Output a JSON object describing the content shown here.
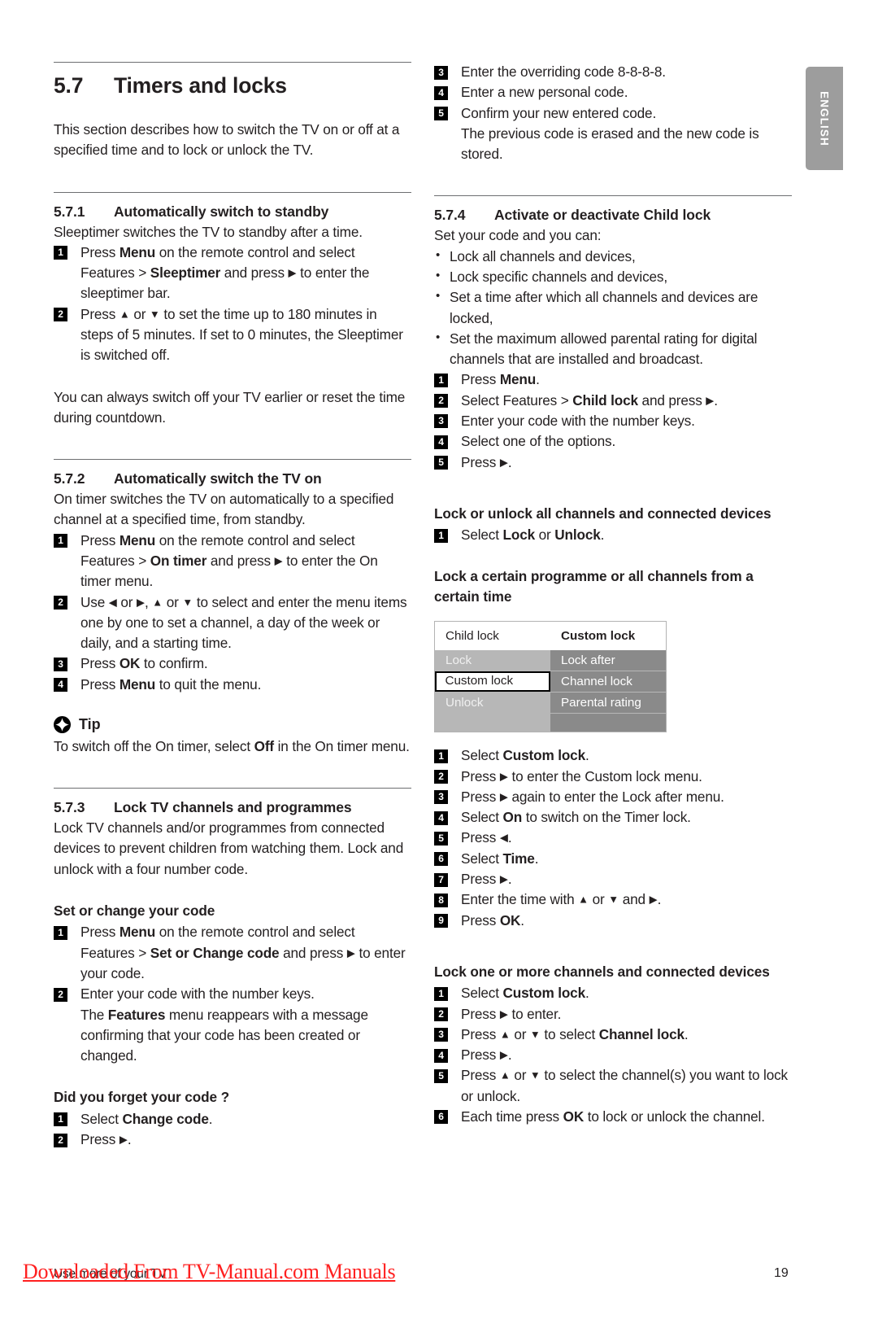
{
  "page": {
    "language_tab": "ENGLISH",
    "page_number": "19",
    "footer_text": "Use more of your TV",
    "watermark": "Downloaded From TV-Manual.com Manuals"
  },
  "left_column": {
    "section": {
      "number": "5.7",
      "title": "Timers and locks",
      "intro": "This section describes how to switch the TV on or off at a specified time and to lock or unlock the TV."
    },
    "sub_571": {
      "number": "5.7.1",
      "title": "Automatically switch to standby",
      "intro": "Sleeptimer switches the TV to standby after a time.",
      "steps": [
        {
          "n": "1",
          "html": "Press <b>Menu</b> on the remote control and select Features &gt; <b>Sleeptimer</b> and press <span class=\"arrow\">▶</span> to enter the sleeptimer bar."
        },
        {
          "n": "2",
          "html": "Press <span class=\"arrow\">▲</span> or <span class=\"arrow\">▼</span> to set the time up to 180 minutes in steps of 5 minutes. If set to 0 minutes, the Sleeptimer is switched off."
        }
      ],
      "note": "You can always switch off your TV earlier or reset the time during countdown."
    },
    "sub_572": {
      "number": "5.7.2",
      "title": "Automatically switch the TV on",
      "intro": "On timer switches the TV on automatically to a specified channel at a specified time, from standby.",
      "steps": [
        {
          "n": "1",
          "html": "Press <b>Menu</b> on the remote control and select Features &gt; <b>On timer</b> and press <span class=\"arrow\">▶</span> to enter the On timer menu."
        },
        {
          "n": "2",
          "html": "Use <span class=\"arrow\">◀</span> or <span class=\"arrow\">▶</span>, <span class=\"arrow\">▲</span> or <span class=\"arrow\">▼</span> to select and enter the menu items one by one to set a channel, a day of the week or daily, and a starting time."
        },
        {
          "n": "3",
          "html": "Press <b>OK</b> to confirm."
        },
        {
          "n": "4",
          "html": "Press <b>Menu</b> to quit the menu."
        }
      ],
      "tip_label": "Tip",
      "tip_html": "To switch off the On timer, select <b>Off</b> in the On timer menu."
    },
    "sub_573": {
      "number": "5.7.3",
      "title": "Lock TV channels and programmes",
      "intro": "Lock TV channels and/or programmes from connected devices to prevent children from watching them. Lock and unlock with a four number code.",
      "set_code_head": "Set or change your code",
      "set_code_steps": [
        {
          "n": "1",
          "html": "Press <b>Menu</b> on the remote control and select Features &gt; <b>Set or Change code</b> and press <span class=\"arrow\">▶</span> to enter your code."
        },
        {
          "n": "2",
          "html": "Enter your code with the number keys.<br>The <b>Features</b> menu reappears with a message confirming that your code has been created or changed."
        }
      ],
      "forgot_head": "Did you forget your code ?",
      "forgot_steps": [
        {
          "n": "1",
          "html": "Select <b>Change code</b>."
        },
        {
          "n": "2",
          "html": "Press <span class=\"arrow\">▶</span>."
        }
      ]
    }
  },
  "right_column": {
    "forgot_steps_cont": [
      {
        "n": "3",
        "html": "Enter the overriding code 8-8-8-8."
      },
      {
        "n": "4",
        "html": "Enter a new personal code."
      },
      {
        "n": "5",
        "html": "Confirm your new entered code.<br>The previous code is erased and the new code is stored."
      }
    ],
    "sub_574": {
      "number": "5.7.4",
      "title": "Activate or deactivate Child lock",
      "intro": "Set your code and you can:",
      "bullets": [
        "Lock all channels and devices,",
        "Lock specific channels and devices,",
        "Set a time after which all channels and devices are locked,",
        "Set the maximum allowed parental rating for digital channels that are installed and broadcast."
      ],
      "steps": [
        {
          "n": "1",
          "html": "Press <b>Menu</b>."
        },
        {
          "n": "2",
          "html": "Select Features &gt; <b>Child lock</b> and press <span class=\"arrow\">▶</span>."
        },
        {
          "n": "3",
          "html": "Enter your code with the number keys."
        },
        {
          "n": "4",
          "html": "Select one of the options."
        },
        {
          "n": "5",
          "html": "Press <span class=\"arrow\">▶</span>."
        }
      ]
    },
    "lock_all": {
      "heading": "Lock or unlock all channels and connected devices",
      "steps": [
        {
          "n": "1",
          "html": "Select <b>Lock</b> or <b>Unlock</b>."
        }
      ]
    },
    "lock_certain": {
      "heading": "Lock a certain programme or all channels from a certain time",
      "menu": {
        "header_left": "Child lock",
        "header_right": "Custom lock",
        "left_items": [
          "Lock",
          "Custom lock",
          "Unlock"
        ],
        "left_selected_index": 1,
        "right_items": [
          "Lock after",
          "Channel lock",
          "Parental rating"
        ]
      },
      "steps": [
        {
          "n": "1",
          "html": "Select <b>Custom lock</b>."
        },
        {
          "n": "2",
          "html": "Press <span class=\"arrow\">▶</span> to enter the Custom lock menu."
        },
        {
          "n": "3",
          "html": "Press <span class=\"arrow\">▶</span> again to enter the Lock after menu."
        },
        {
          "n": "4",
          "html": "Select <b>On</b> to switch on the Timer lock."
        },
        {
          "n": "5",
          "html": "Press <span class=\"arrow\">◀</span>."
        },
        {
          "n": "6",
          "html": "Select <b>Time</b>."
        },
        {
          "n": "7",
          "html": "Press <span class=\"arrow\">▶</span>."
        },
        {
          "n": "8",
          "html": "Enter the time with <span class=\"arrow\">▲</span> or <span class=\"arrow\">▼</span> and <span class=\"arrow\">▶</span>."
        },
        {
          "n": "9",
          "html": "Press <b>OK</b>."
        }
      ]
    },
    "lock_one_or_more": {
      "heading": "Lock one or more channels and connected devices",
      "steps": [
        {
          "n": "1",
          "html": "Select <b>Custom lock</b>."
        },
        {
          "n": "2",
          "html": "Press <span class=\"arrow\">▶</span> to enter."
        },
        {
          "n": "3",
          "html": "Press <span class=\"arrow\">▲</span> or <span class=\"arrow\">▼</span> to select <b>Channel lock</b>."
        },
        {
          "n": "4",
          "html": "Press <span class=\"arrow\">▶</span>."
        },
        {
          "n": "5",
          "html": "Press <span class=\"arrow\">▲</span> or <span class=\"arrow\">▼</span> to select the channel(s) you want to lock or unlock."
        },
        {
          "n": "6",
          "html": "Each time press <b>OK</b> to lock or unlock the channel."
        }
      ]
    }
  },
  "colors": {
    "rule": "#6d6e71",
    "tab_bg": "#9d9d9d",
    "menu_left_bg": "#b7b7b7",
    "menu_right_bg": "#8a8a8a",
    "watermark": "#ff2020"
  }
}
